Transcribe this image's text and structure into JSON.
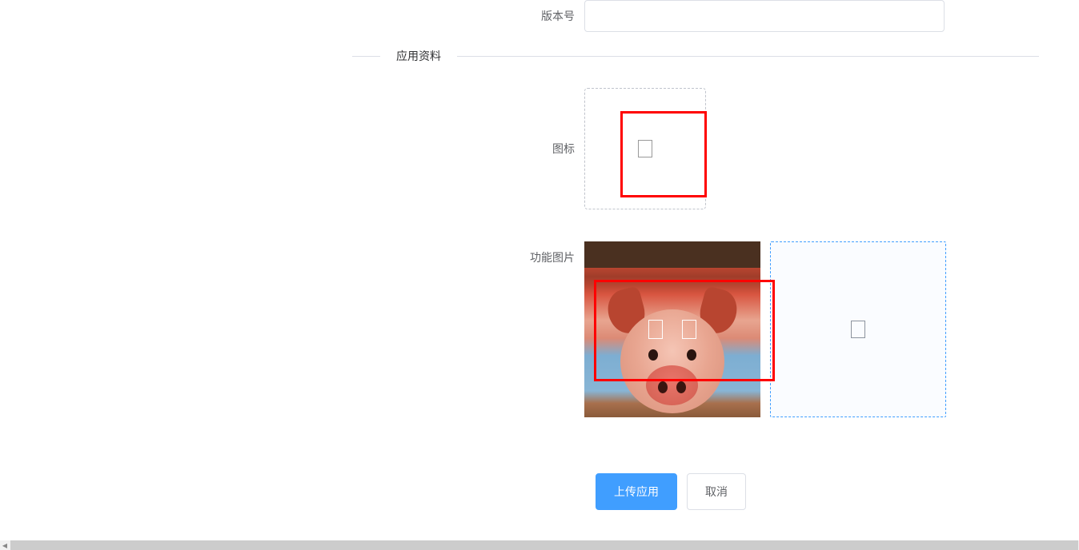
{
  "form": {
    "version_label": "版本号",
    "version_value": "",
    "icon_label": "图标",
    "feature_images_label": "功能图片"
  },
  "section": {
    "app_info_title": "应用资料"
  },
  "buttons": {
    "upload": "上传应用",
    "cancel": "取消"
  },
  "icons": {
    "placeholder": "placeholder-icon",
    "add": "add-icon"
  }
}
